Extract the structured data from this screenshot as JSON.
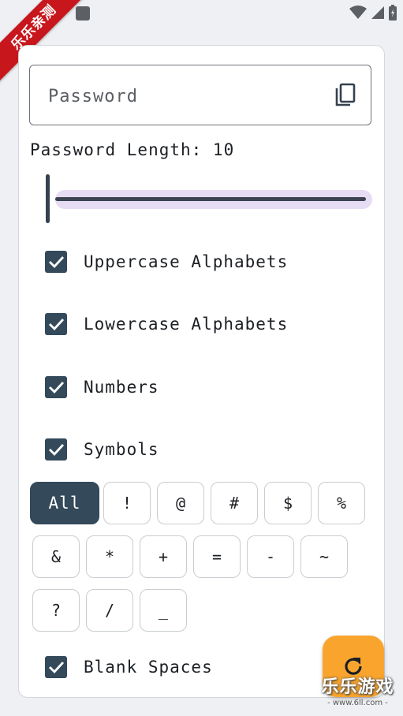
{
  "password": {
    "placeholder": "Password"
  },
  "length": {
    "label": "Password Length: 10",
    "value": 10
  },
  "options": [
    {
      "label": "Uppercase Alphabets",
      "checked": true
    },
    {
      "label": "Lowercase Alphabets",
      "checked": true
    },
    {
      "label": "Numbers",
      "checked": true
    },
    {
      "label": "Symbols",
      "checked": true
    }
  ],
  "symbols": {
    "row1": [
      "All",
      "!",
      "@",
      "#",
      "$",
      "%"
    ],
    "row2": [
      "&",
      "*",
      "+",
      "=",
      "-",
      "~"
    ],
    "row3": [
      "?",
      "/",
      "_"
    ],
    "selected": "All"
  },
  "blank_spaces": {
    "label": "Blank Spaces",
    "checked": true
  },
  "watermark": {
    "badge": "乐乐亲测",
    "brand": "乐乐游戏",
    "url": "- www.6ll.com -"
  },
  "colors": {
    "accent": "#34495a",
    "fab": "#f9a52d",
    "track": "#e6dcf4",
    "badge": "#c8161d"
  },
  "icons": {
    "copy": "copy-icon",
    "refresh": "refresh-icon",
    "check": "check-icon"
  }
}
